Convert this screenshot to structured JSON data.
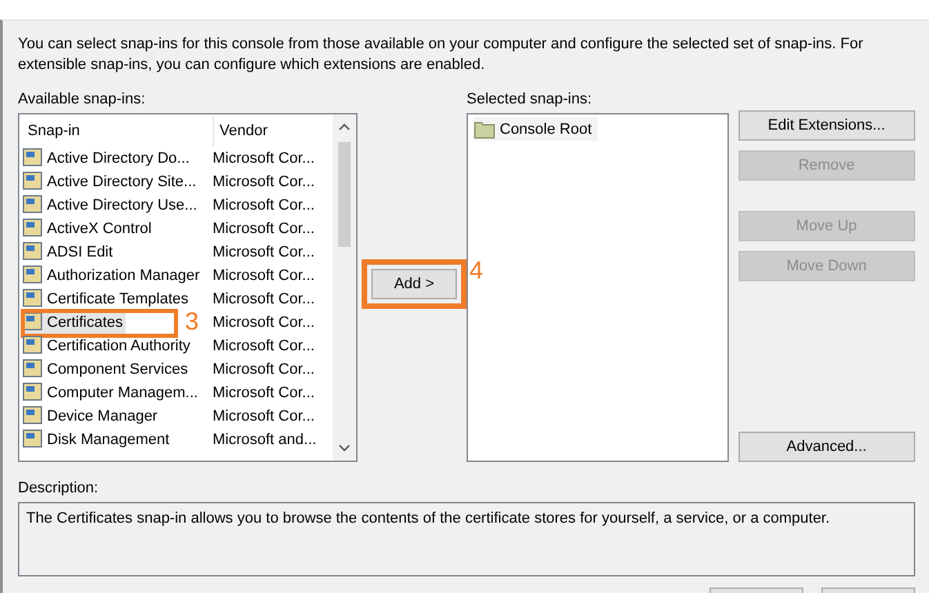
{
  "intro": "You can select snap-ins for this console from those available on your computer and configure the selected set of snap-ins. For extensible snap-ins, you can configure which extensions are enabled.",
  "available": {
    "label": "Available snap-ins:",
    "columns": [
      "Snap-in",
      "Vendor"
    ],
    "rows": [
      {
        "name": "Active Directory Do...",
        "vendor": "Microsoft Cor...",
        "selected": false
      },
      {
        "name": "Active Directory Site...",
        "vendor": "Microsoft Cor...",
        "selected": false
      },
      {
        "name": "Active Directory Use...",
        "vendor": "Microsoft Cor...",
        "selected": false
      },
      {
        "name": "ActiveX Control",
        "vendor": "Microsoft Cor...",
        "selected": false
      },
      {
        "name": "ADSI Edit",
        "vendor": "Microsoft Cor...",
        "selected": false
      },
      {
        "name": "Authorization Manager",
        "vendor": "Microsoft Cor...",
        "selected": false
      },
      {
        "name": "Certificate Templates",
        "vendor": "Microsoft Cor...",
        "selected": false
      },
      {
        "name": "Certificates",
        "vendor": "Microsoft Cor...",
        "selected": true,
        "callout": "3"
      },
      {
        "name": "Certification Authority",
        "vendor": "Microsoft Cor...",
        "selected": false
      },
      {
        "name": "Component Services",
        "vendor": "Microsoft Cor...",
        "selected": false
      },
      {
        "name": "Computer Managem...",
        "vendor": "Microsoft Cor...",
        "selected": false
      },
      {
        "name": "Device Manager",
        "vendor": "Microsoft Cor...",
        "selected": false
      },
      {
        "name": "Disk Management",
        "vendor": "Microsoft and...",
        "selected": false
      }
    ]
  },
  "add_button": {
    "label": "Add >",
    "callout": "4"
  },
  "selected": {
    "label": "Selected snap-ins:",
    "items": [
      "Console Root"
    ]
  },
  "side_buttons": [
    {
      "label": "Edit Extensions...",
      "disabled": false,
      "kind": "top"
    },
    {
      "label": "Remove",
      "disabled": true,
      "kind": "top"
    },
    {
      "label": "Move Up",
      "disabled": true,
      "kind": "gap"
    },
    {
      "label": "Move Down",
      "disabled": true,
      "kind": "top"
    },
    {
      "label": "Advanced...",
      "disabled": false,
      "kind": "bottom"
    }
  ],
  "description": {
    "label": "Description:",
    "text": "The Certificates snap-in allows you to browse the contents of the certificate stores for yourself, a service, or a computer."
  }
}
